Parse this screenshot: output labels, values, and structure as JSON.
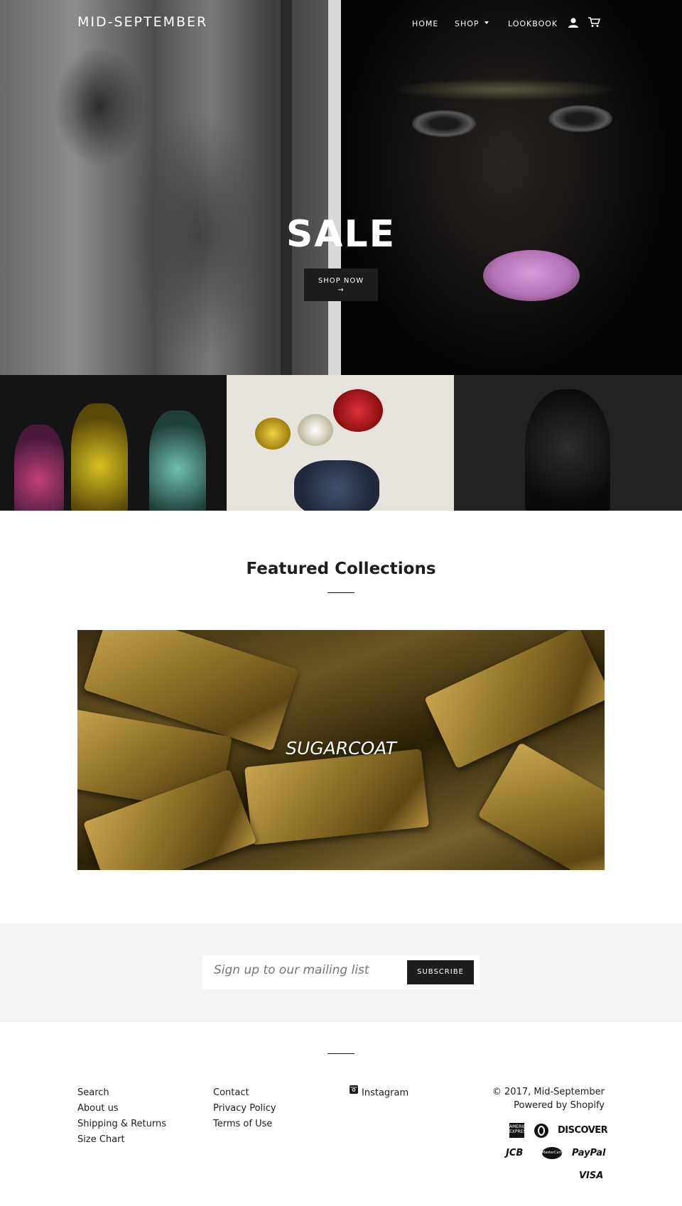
{
  "header": {
    "logo": "MID-SEPTEMBER",
    "nav": {
      "home": "HOME",
      "shop": "SHOP",
      "lookbook": "LOOKBOOK"
    },
    "icons": [
      "account-icon",
      "cart-icon"
    ]
  },
  "hero": {
    "title": "SALE",
    "button_label": "SHOP NOW",
    "button_arrow": "→"
  },
  "featured": {
    "title": "Featured Collections",
    "collection_label": "SUGARCOAT"
  },
  "newsletter": {
    "placeholder": "Sign up to our mailing list",
    "button_label": "SUBSCRIBE"
  },
  "footer": {
    "col1": [
      "Search",
      "About us",
      "Shipping & Returns",
      "Size Chart"
    ],
    "col2": [
      "Contact",
      "Privacy Policy",
      "Terms of Use"
    ],
    "social": {
      "label": "Instagram",
      "icon": "instagram-icon"
    },
    "copyright": "© 2017, Mid-September",
    "powered": "Powered by Shopify",
    "payments": {
      "amex": "AMERICAN EXPRESS",
      "diners": "",
      "discover": "DISCOVER",
      "jcb": "JCB",
      "master": "MasterCard",
      "paypal": "PayPal",
      "visa": "VISA"
    }
  },
  "colors": {
    "text": "#1c1d1d",
    "button_bg": "#1c1d1d",
    "newsletter_bg": "#f4f4f4",
    "white": "#ffffff"
  }
}
